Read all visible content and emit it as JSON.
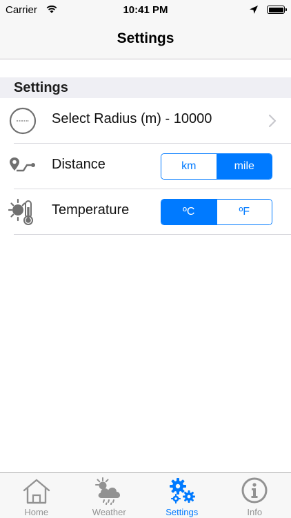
{
  "status_bar": {
    "carrier": "Carrier",
    "time": "10:41 PM"
  },
  "nav": {
    "title": "Settings"
  },
  "section": {
    "header": "Settings"
  },
  "rows": {
    "radius": {
      "label": "Select Radius (m)  -  10000",
      "icon": "radius-icon"
    },
    "distance": {
      "label": "Distance",
      "icon": "route-icon",
      "options": [
        "km",
        "mile"
      ],
      "selected": "mile"
    },
    "temperature": {
      "label": "Temperature",
      "icon": "thermometer-sun-icon",
      "options": [
        "ºC",
        "ºF"
      ],
      "selected": "ºC"
    }
  },
  "tabs": [
    {
      "label": "Home",
      "icon": "home-icon"
    },
    {
      "label": "Weather",
      "icon": "weather-icon"
    },
    {
      "label": "Settings",
      "icon": "gears-icon",
      "active": true
    },
    {
      "label": "Info",
      "icon": "info-icon"
    }
  ],
  "colors": {
    "accent": "#007aff",
    "inactive": "#929292",
    "bar_background": "#f7f7f7",
    "section_background": "#efeff4"
  }
}
